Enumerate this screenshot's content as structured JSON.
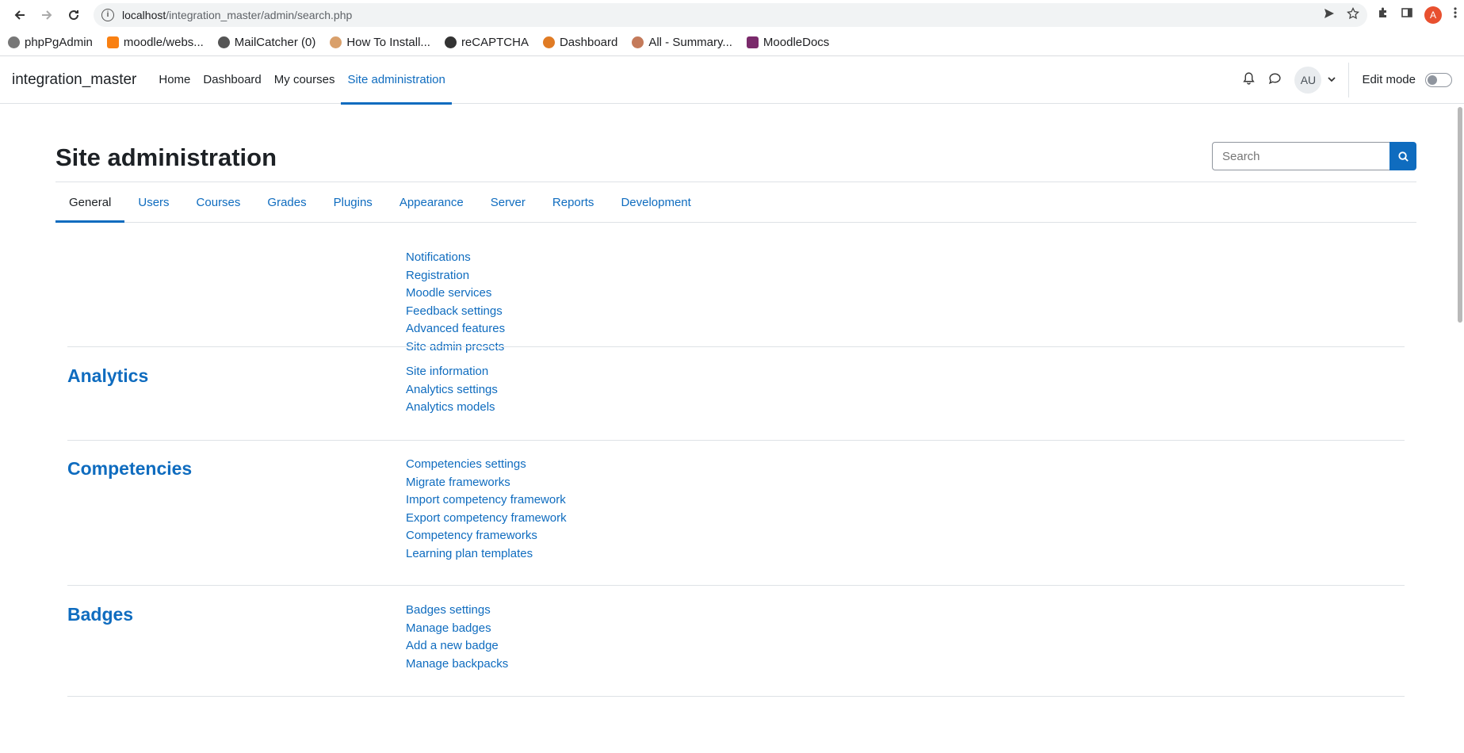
{
  "browser": {
    "url_host": "localhost",
    "url_path": "/integration_master/admin/search.php",
    "profile_initial": "A",
    "bookmarks": [
      "phpPgAdmin",
      "moodle/webs...",
      "MailCatcher (0)",
      "How To Install...",
      "reCAPTCHA",
      "Dashboard",
      "All - Summary...",
      "MoodleDocs"
    ]
  },
  "navbar": {
    "brand": "integration_master",
    "items": [
      "Home",
      "Dashboard",
      "My courses",
      "Site administration"
    ],
    "user_initials": "AU",
    "edit_mode_label": "Edit mode"
  },
  "page": {
    "title": "Site administration",
    "search_placeholder": "Search",
    "tabs": [
      "General",
      "Users",
      "Courses",
      "Grades",
      "Plugins",
      "Appearance",
      "Server",
      "Reports",
      "Development"
    ],
    "active_tab": "General",
    "general_links": [
      "Notifications",
      "Registration",
      "Moodle services",
      "Feedback settings",
      "Advanced features",
      "Site admin presets"
    ],
    "sections": [
      {
        "heading": "Analytics",
        "links": [
          "Site information",
          "Analytics settings",
          "Analytics models"
        ]
      },
      {
        "heading": "Competencies",
        "links": [
          "Competencies settings",
          "Migrate frameworks",
          "Import competency framework",
          "Export competency framework",
          "Competency frameworks",
          "Learning plan templates"
        ]
      },
      {
        "heading": "Badges",
        "links": [
          "Badges settings",
          "Manage badges",
          "Add a new badge",
          "Manage backpacks"
        ]
      }
    ]
  },
  "colors": {
    "link": "#0f6cbf",
    "text": "#1d2125",
    "border": "#dee2e6"
  }
}
